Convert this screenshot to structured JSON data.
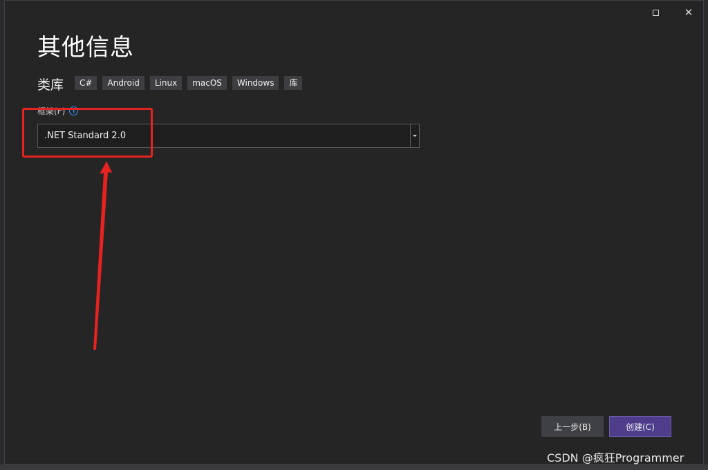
{
  "window": {
    "title": "其他信息",
    "subtitle": "类库",
    "tags": [
      "C#",
      "Android",
      "Linux",
      "macOS",
      "Windows",
      "库"
    ]
  },
  "framework": {
    "label": "框架(F)",
    "selected": ".NET Standard 2.0"
  },
  "buttons": {
    "back": "上一步(B)",
    "create": "创建(C)"
  },
  "watermark": "CSDN @疯狂Programmer",
  "colors": {
    "window_bg": "#252526",
    "accent_button": "#4f3d8c",
    "annotation_red": "#e8221f",
    "info_blue": "#3794ff"
  },
  "icons": {
    "maximize": "maximize-icon",
    "close": "close-icon",
    "info": "info-icon",
    "dropdown": "chevron-down-icon"
  }
}
